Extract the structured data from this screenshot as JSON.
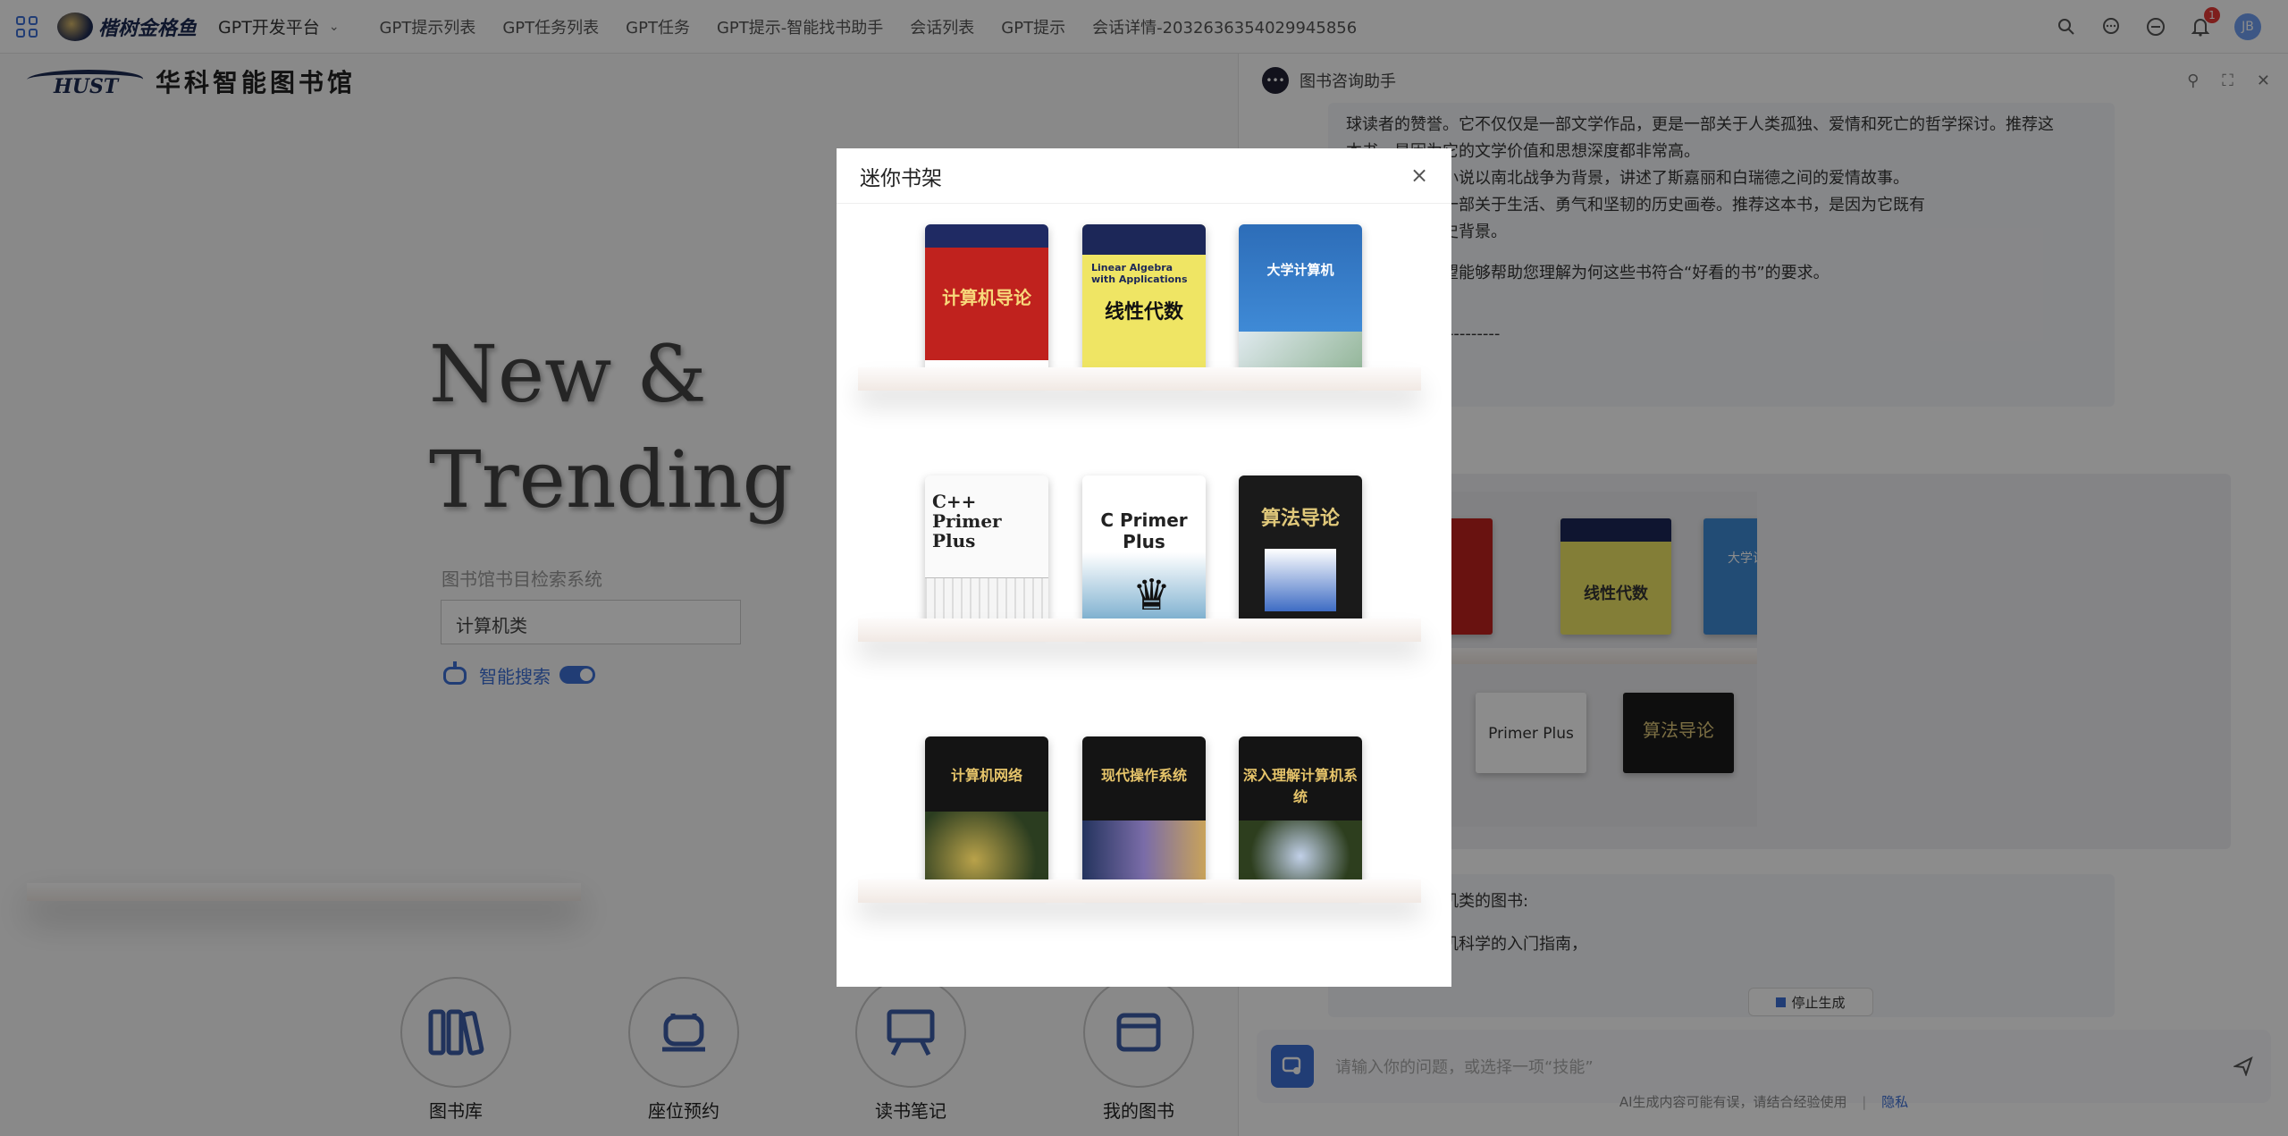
{
  "topbar": {
    "brand": "楷树金格鱼",
    "platform": "GPT开发平台",
    "tabs": [
      "GPT提示列表",
      "GPT任务列表",
      "GPT任务",
      "GPT提示-智能找书助手",
      "会话列表",
      "GPT提示",
      "会话详情-2032636354029945856"
    ],
    "notification_count": "1",
    "user_initial": "JB"
  },
  "library": {
    "logo_text": "HUST",
    "name": "华科智能图书馆",
    "hero_line1": "New &",
    "hero_line2": "Trending",
    "search_label": "图书馆书目检索系统",
    "search_value": "计算机类",
    "smart_search_label": "智能搜索",
    "smart_search_on": true,
    "features": [
      {
        "label": "图书库",
        "icon": "books-icon"
      },
      {
        "label": "座位预约",
        "icon": "seat-icon"
      },
      {
        "label": "读书笔记",
        "icon": "easel-icon"
      },
      {
        "label": "我的图书",
        "icon": "my-books-icon"
      }
    ]
  },
  "chat": {
    "title": "图书咨询助手",
    "msg1": [
      "球读者的赞誉。它不仅仅是一部文学作品，更是一部关于人类孤独、爱情和死亡的哲学探讨。推荐这",
      "本书，是因为它的文学价值和思想深度都非常高。",
      "米切尔的这部小说以南北战争为背景，讲述了斯嘉丽和白瑞德之间的爱情故事。",
      "爱小说，更是一部关于生活、勇气和坚韧的历史画卷。推荐这本书，是因为它既有",
      "又有深刻的历史背景。",
      "摘要说明，希望能够帮助您理解为何这些书符合“好看的书”的要求。",
      "搜索---------------------"
    ],
    "mini_shelf_titles": [
      "线性代数",
      "大学计算机",
      "Primer Plus",
      "算法导论"
    ],
    "msg2": [
      "荐了以下计算机类的图书:",
      "这本书是计算机科学的入门指南，"
    ],
    "stop_label": "停止生成",
    "input_placeholder": "请输入你的问题，或选择一项“技能”",
    "disclaimer": "AI生成内容可能有误，请结合经验使用",
    "privacy": "隐私"
  },
  "modal": {
    "title": "迷你书架",
    "books": [
      {
        "title": "计算机导论"
      },
      {
        "title": "线性代数",
        "en": "Linear Algebra with Applications"
      },
      {
        "title": "大学计算机"
      },
      {
        "title": "C++ Primer Plus"
      },
      {
        "title": "C Primer Plus"
      },
      {
        "title": "算法导论"
      },
      {
        "title": "计算机网络"
      },
      {
        "title": "现代操作系统"
      },
      {
        "title": "深入理解计算机系统"
      }
    ]
  },
  "colors": {
    "accent": "#3d6fd6",
    "badge": "#e53935"
  }
}
